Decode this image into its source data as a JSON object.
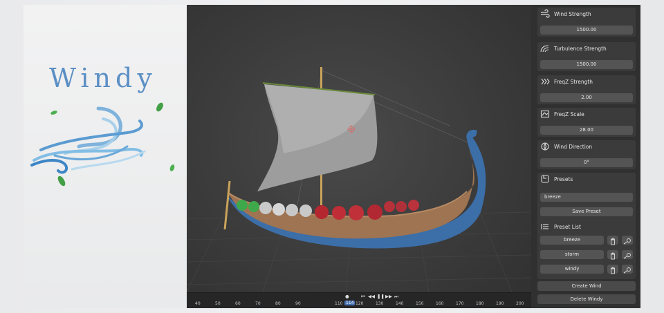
{
  "logo": {
    "title": "Windy"
  },
  "panel": {
    "wind_strength": {
      "label": "Wind Strength",
      "value": "1500.00"
    },
    "turbulence": {
      "label": "Turbulence Strength",
      "value": "1500.00"
    },
    "freqz_strength": {
      "label": "FreqZ Strength",
      "value": "2.00"
    },
    "freqz_scale": {
      "label": "FreqZ Scale",
      "value": "28.00"
    },
    "wind_direction": {
      "label": "Wind Direction",
      "value": "0°"
    },
    "presets": {
      "label": "Presets",
      "input_value": "breeze",
      "save_label": "Save Preset"
    },
    "preset_list": {
      "label": "Preset List",
      "items": [
        {
          "name": "breeze"
        },
        {
          "name": "storm"
        },
        {
          "name": "windy"
        }
      ]
    },
    "create_label": "Create Wind",
    "delete_label": "Delete Windy"
  },
  "timeline": {
    "ticks": [
      "40",
      "50",
      "60",
      "70",
      "80",
      "90",
      "110",
      "120",
      "130",
      "140",
      "150",
      "160",
      "170",
      "180",
      "190",
      "200"
    ],
    "current_frame": "114"
  },
  "icons": {
    "wind_strength": "wind-icon",
    "turbulence": "turbulence-icon",
    "freqz_strength": "chevrons-icon",
    "freqz_scale": "scale-icon",
    "wind_direction": "compass-icon",
    "presets": "preset-icon",
    "preset_list": "list-icon",
    "delete": "trash-icon",
    "load": "key-icon"
  },
  "colors": {
    "accent": "#4772b3",
    "panel_bg": "#303030",
    "field_bg": "#545454",
    "logo_blue": "#5b8fc4",
    "leaf_green": "#4caf50"
  }
}
